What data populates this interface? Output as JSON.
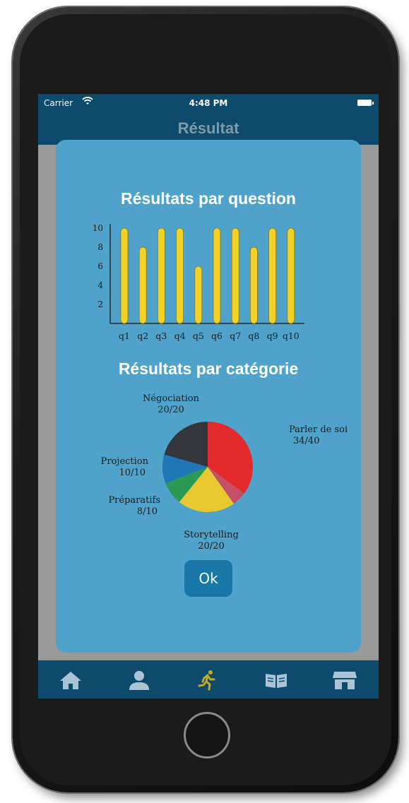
{
  "statusbar": {
    "carrier": "Carrier",
    "time": "4:48 PM"
  },
  "navbar": {
    "title": "Résultat"
  },
  "modal": {
    "question_title": "Résultats par question",
    "category_title": "Résultats par catégorie",
    "ok_label": "Ok"
  },
  "chart_data": [
    {
      "type": "bar",
      "title": "Résultats par question",
      "categories": [
        "q1",
        "q2",
        "q3",
        "q4",
        "q5",
        "q6",
        "q7",
        "q8",
        "q9",
        "q10"
      ],
      "values": [
        10,
        8,
        10,
        10,
        6,
        10,
        10,
        8,
        10,
        10
      ],
      "yticks": [
        2,
        4,
        6,
        8,
        10
      ],
      "ylim": [
        0,
        10
      ],
      "xlabel": "",
      "ylabel": "",
      "color": "#f2d128"
    },
    {
      "type": "pie",
      "title": "Résultats par catégorie",
      "slices": [
        {
          "label": "Parler de soi",
          "value_text": "34/40",
          "value": 34,
          "color": "#e32b2e"
        },
        {
          "label": "",
          "value_text": "",
          "value": 5,
          "color": "#c45068"
        },
        {
          "label": "Storytelling",
          "value_text": "20/20",
          "value": 20,
          "color": "#e8c82e"
        },
        {
          "label": "Préparatifs",
          "value_text": "8/10",
          "value": 8,
          "color": "#2a9a55"
        },
        {
          "label": "Projection",
          "value_text": "10/10",
          "value": 10,
          "color": "#1f78b5"
        },
        {
          "label": "Négociation",
          "value_text": "20/20",
          "value": 20,
          "color": "#33363d"
        }
      ]
    }
  ],
  "tabbar": {
    "items": [
      {
        "icon": "home-icon",
        "active": false
      },
      {
        "icon": "user-icon",
        "active": false
      },
      {
        "icon": "running-icon",
        "active": true
      },
      {
        "icon": "book-icon",
        "active": false
      },
      {
        "icon": "store-icon",
        "active": false
      }
    ],
    "active_color": "#c8a820",
    "inactive_color": "#a9c4d4"
  }
}
